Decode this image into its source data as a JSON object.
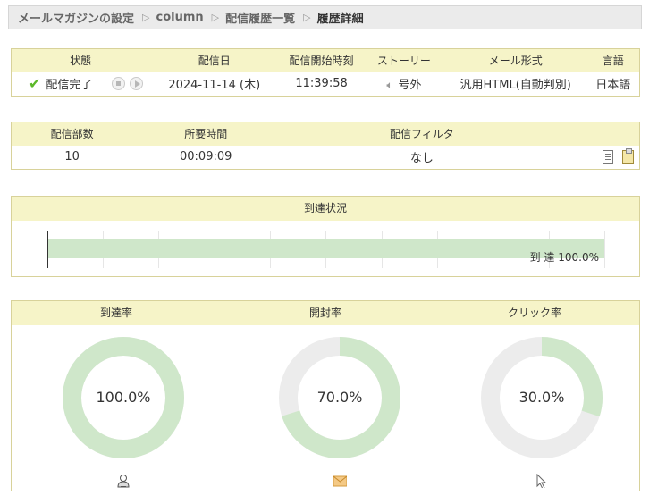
{
  "breadcrumb": {
    "items": [
      "メールマガジンの設定",
      "column",
      "配信履歴一覧",
      "履歴詳細"
    ],
    "separator": "▷"
  },
  "status_table": {
    "headers": [
      "状態",
      "配信日",
      "配信開始時刻",
      "ストーリー",
      "メール形式",
      "言語"
    ],
    "row": {
      "status": "配信完了",
      "date": "2024-11-14 (木)",
      "start_time": "11:39:58",
      "story": "号外",
      "format": "汎用HTML(自動判別)",
      "language": "日本語"
    }
  },
  "summary_table": {
    "headers": [
      "配信部数",
      "所要時間",
      "配信フィルタ"
    ],
    "row": {
      "count": "10",
      "duration": "00:09:09",
      "filter": "なし"
    }
  },
  "arrival": {
    "title": "到達状況",
    "label": "到 達 100.0%",
    "fraction": 1.0,
    "bar_color": "#cfe7ca"
  },
  "rates": {
    "items": [
      {
        "title": "到達率",
        "value": "100.0%",
        "fraction": 1.0,
        "icon": "user-icon"
      },
      {
        "title": "開封率",
        "value": "70.0%",
        "fraction": 0.7,
        "icon": "mail-icon"
      },
      {
        "title": "クリック率",
        "value": "30.0%",
        "fraction": 0.3,
        "icon": "cursor-icon"
      }
    ],
    "fill_color": "#cfe7ca",
    "track_color": "#ececec"
  },
  "colors": {
    "header_bg": "#f6f4c8",
    "border": "#d8d29a",
    "check": "#5cb82a"
  }
}
